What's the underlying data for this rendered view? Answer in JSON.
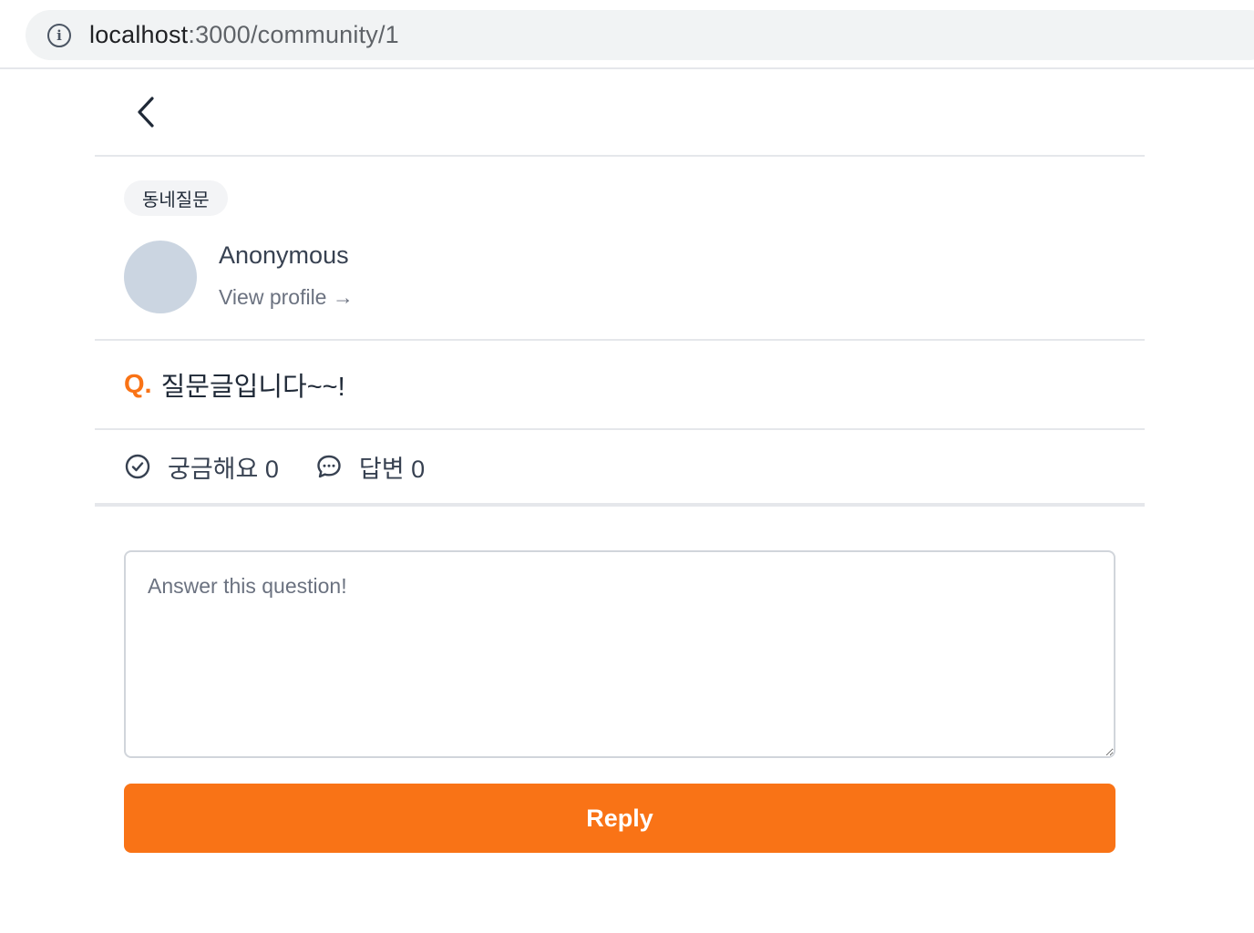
{
  "browser": {
    "url_host": "localhost",
    "url_path": ":3000/community/1",
    "info_icon": "info-icon"
  },
  "header": {
    "back_icon": "chevron-left-icon"
  },
  "post": {
    "category": "동네질문",
    "author": {
      "name": "Anonymous",
      "view_profile_label": "View profile →"
    },
    "question_prefix": "Q.",
    "question_text": "질문글입니다~~!",
    "stats": {
      "curious_label": "궁금해요 0",
      "answers_label": "답변 0"
    }
  },
  "reply": {
    "placeholder": "Answer this question!",
    "button_label": "Reply"
  },
  "colors": {
    "accent": "#f97316",
    "avatar": "#cbd5e1",
    "divider": "#e5e7eb"
  }
}
